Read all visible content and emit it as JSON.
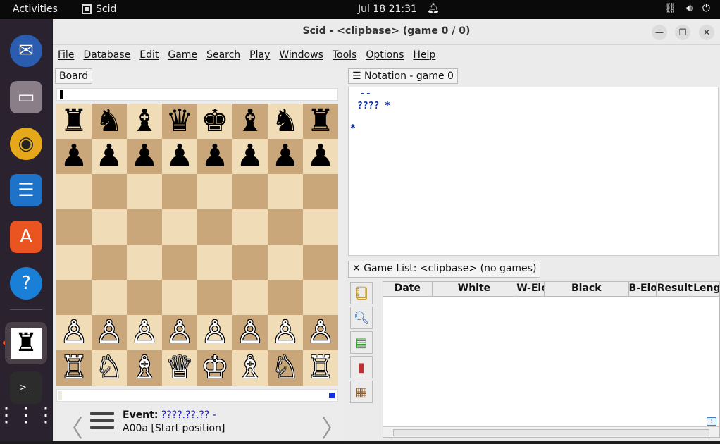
{
  "topbar": {
    "activities": "Activities",
    "app_name": "Scid",
    "clock": "Jul 18  21:31"
  },
  "dock": {
    "items": [
      "thunderbird-icon",
      "files-icon",
      "rhythmbox-icon",
      "writer-icon",
      "app-center-icon",
      "help-icon",
      "scid-icon",
      "terminal-icon",
      "app-grid-icon"
    ]
  },
  "window": {
    "title": "Scid - <clipbase> (game 0 / 0)",
    "menu": [
      "File",
      "Database",
      "Edit",
      "Game",
      "Search",
      "Play",
      "Windows",
      "Tools",
      "Options",
      "Help"
    ]
  },
  "board": {
    "tab_label": "Board",
    "ranks": [
      [
        "♜",
        "♞",
        "♝",
        "♛",
        "♚",
        "♝",
        "♞",
        "♜"
      ],
      [
        "♟",
        "♟",
        "♟",
        "♟",
        "♟",
        "♟",
        "♟",
        "♟"
      ],
      [
        "",
        "",
        "",
        "",
        "",
        "",
        "",
        ""
      ],
      [
        "",
        "",
        "",
        "",
        "",
        "",
        "",
        ""
      ],
      [
        "",
        "",
        "",
        "",
        "",
        "",
        "",
        ""
      ],
      [
        "",
        "",
        "",
        "",
        "",
        "",
        "",
        ""
      ],
      [
        "♙",
        "♙",
        "♙",
        "♙",
        "♙",
        "♙",
        "♙",
        "♙"
      ],
      [
        "♖",
        "♘",
        "♗",
        "♕",
        "♔",
        "♗",
        "♘",
        "♖"
      ]
    ],
    "colors": {
      "light": "#f0ddb8",
      "dark": "#c9a77b"
    }
  },
  "info": {
    "event_label": "Event:",
    "event_value": "????.??.?? -",
    "eco": "A00a [Start position]"
  },
  "notation": {
    "tab_label": "Notation - game 0",
    "line1": "--",
    "line2": "???? *",
    "line3": "*"
  },
  "gamelist": {
    "tab_label": "Game List: <clipbase> (no games)",
    "columns": [
      "Date",
      "White",
      "W-Elo",
      "Black",
      "B-Elo",
      "Result",
      "Length"
    ]
  }
}
